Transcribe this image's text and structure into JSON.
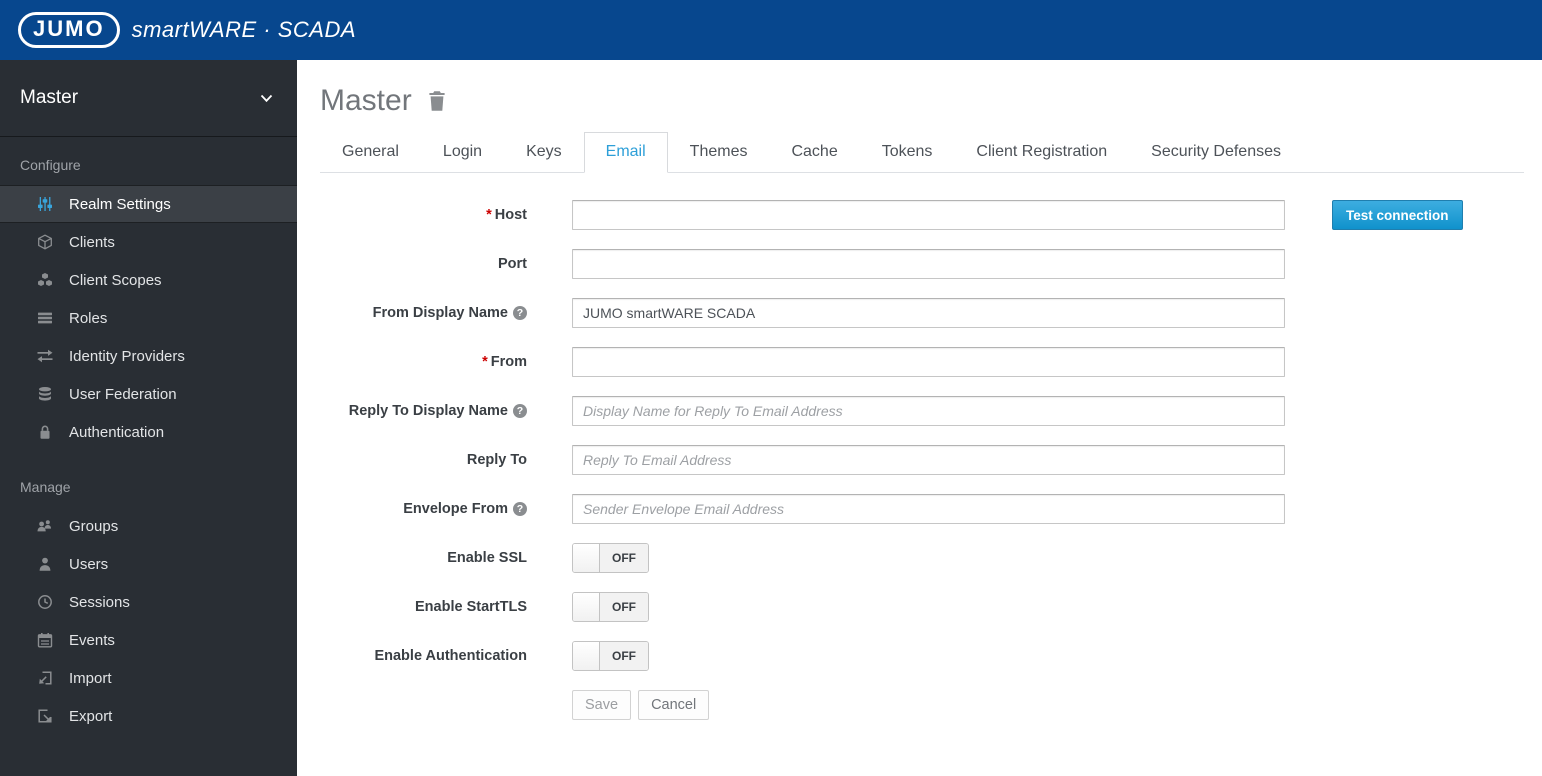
{
  "colors": {
    "header_blue": "#07478e",
    "sidebar_bg": "#292e34",
    "accent_blue": "#39a5dc",
    "active_tab_blue": "#2d9fd8",
    "primary_button_blue": "#1092cc",
    "required_red": "#cc0000"
  },
  "header": {
    "logo_text": "JUMO",
    "brand": "smartWARE · SCADA"
  },
  "sidebar": {
    "realm_selector": "Master",
    "sections": [
      {
        "label": "Configure",
        "items": [
          {
            "label": "Realm Settings",
            "icon": "sliders-icon",
            "active": true
          },
          {
            "label": "Clients",
            "icon": "cube-icon",
            "active": false
          },
          {
            "label": "Client Scopes",
            "icon": "cubes-icon",
            "active": false
          },
          {
            "label": "Roles",
            "icon": "list-icon",
            "active": false
          },
          {
            "label": "Identity Providers",
            "icon": "exchange-icon",
            "active": false
          },
          {
            "label": "User Federation",
            "icon": "database-icon",
            "active": false
          },
          {
            "label": "Authentication",
            "icon": "lock-icon",
            "active": false
          }
        ]
      },
      {
        "label": "Manage",
        "items": [
          {
            "label": "Groups",
            "icon": "group-icon",
            "active": false
          },
          {
            "label": "Users",
            "icon": "user-icon",
            "active": false
          },
          {
            "label": "Sessions",
            "icon": "clock-icon",
            "active": false
          },
          {
            "label": "Events",
            "icon": "calendar-icon",
            "active": false
          },
          {
            "label": "Import",
            "icon": "import-icon",
            "active": false
          },
          {
            "label": "Export",
            "icon": "export-icon",
            "active": false
          }
        ]
      }
    ]
  },
  "page": {
    "title": "Master",
    "tabs": [
      {
        "label": "General",
        "active": false
      },
      {
        "label": "Login",
        "active": false
      },
      {
        "label": "Keys",
        "active": false
      },
      {
        "label": "Email",
        "active": true
      },
      {
        "label": "Themes",
        "active": false
      },
      {
        "label": "Cache",
        "active": false
      },
      {
        "label": "Tokens",
        "active": false
      },
      {
        "label": "Client Registration",
        "active": false
      },
      {
        "label": "Security Defenses",
        "active": false
      }
    ],
    "form": {
      "required_marker": "*",
      "help_glyph": "?",
      "host": {
        "label": "Host",
        "required": true,
        "value": ""
      },
      "port": {
        "label": "Port",
        "value": ""
      },
      "from_display_name": {
        "label": "From Display Name",
        "value": "JUMO smartWARE SCADA"
      },
      "from": {
        "label": "From",
        "required": true,
        "value": ""
      },
      "reply_to_display_name": {
        "label": "Reply To Display Name",
        "placeholder": "Display Name for Reply To Email Address"
      },
      "reply_to": {
        "label": "Reply To",
        "placeholder": "Reply To Email Address"
      },
      "envelope_from": {
        "label": "Envelope From",
        "placeholder": "Sender Envelope Email Address"
      },
      "enable_ssl": {
        "label": "Enable SSL",
        "state": "OFF"
      },
      "enable_starttls": {
        "label": "Enable StartTLS",
        "state": "OFF"
      },
      "enable_authentication": {
        "label": "Enable Authentication",
        "state": "OFF"
      },
      "buttons": {
        "test_connection": "Test connection",
        "save": "Save",
        "cancel": "Cancel"
      }
    }
  }
}
